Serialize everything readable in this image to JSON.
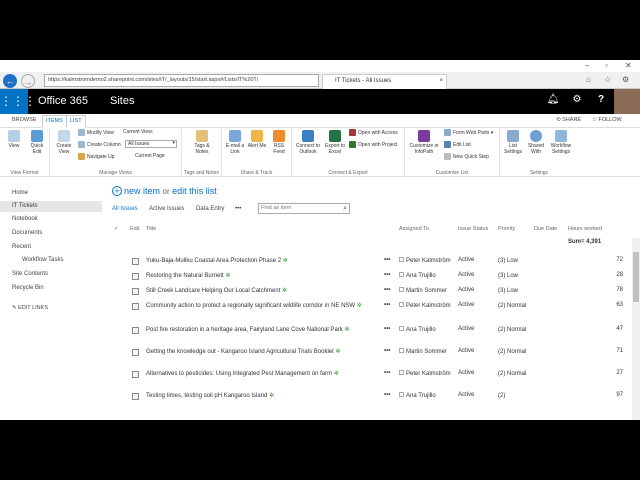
{
  "browser": {
    "url": "https://kalmstromdemo2.sharepoint.com/sites/IT/_layouts/15/start.aspx#/Lists/IT%20Ti",
    "tab_title": "IT Tickets - All Issues",
    "tab_close": "×"
  },
  "suitebar": {
    "brand": "Office 365",
    "app": "Sites"
  },
  "ribbon_tabs": [
    "BROWSE",
    "ITEMS",
    "LIST"
  ],
  "share_label": "SHARE",
  "follow_label": "FOLLOW",
  "ribbon": {
    "view_format": {
      "label": "View Format",
      "view": "View",
      "quick_edit": "Quick Edit"
    },
    "manage_views": {
      "label": "Manage Views",
      "create_view": "Create View",
      "modify_view": "Modify View",
      "create_column": "Create Column",
      "navigate_up": "Navigate Up",
      "current_view_label": "Current View:",
      "current_view_value": "All Issues",
      "current_page": "Current Page"
    },
    "tags_notes": {
      "label": "Tags and Notes",
      "tags": "Tags & Notes"
    },
    "share_track": {
      "label": "Share & Track",
      "email": "E-mail a Link",
      "alert": "Alert Me",
      "rss": "RSS Feed"
    },
    "connect_export": {
      "label": "Connect & Export",
      "outlook": "Connect to Outlook",
      "excel": "Export to Excel",
      "access": "Open with Access",
      "project": "Open with Project"
    },
    "customize_list": {
      "label": "Customize List",
      "infopath": "Customize in InfoPath",
      "form_web_parts": "Form Web Parts",
      "edit_list": "Edit List",
      "quick_step": "New Quick Step"
    },
    "settings": {
      "label": "Settings",
      "list_settings": "List Settings",
      "shared_with": "Shared With",
      "workflow_settings": "Workflow Settings"
    }
  },
  "leftnav": {
    "items": [
      "Home",
      "IT Tickets",
      "Notebook",
      "Documents",
      "Recent",
      "Workflow Tasks",
      "Site Contents",
      "Recycle Bin"
    ],
    "edit_links": "EDIT LINKS"
  },
  "list": {
    "new_item": "new item",
    "or_text": "or",
    "edit_list": "edit this list",
    "views": [
      "All Issues",
      "Active Issues",
      "Data Entry"
    ],
    "more_views": "•••",
    "search_placeholder": "Find an item",
    "columns": {
      "edit": "Edit",
      "title": "Title",
      "assigned": "Assigned To",
      "status": "Issue Status",
      "priority": "Priority",
      "due": "Due Date",
      "hours": "Hours worked"
    },
    "sum": "Sum= 4,391",
    "new_marker": "✲",
    "row_menu": "•••",
    "rows": [
      {
        "title": "Yuku-Baja-Muliku Coastal Area Protection Phase 2",
        "assigned": "Peter Kalmström",
        "status": "Active",
        "priority": "(3) Low",
        "hours": "72"
      },
      {
        "title": "Restoring the Natural Burnett",
        "assigned": "Ana Trujillo",
        "status": "Active",
        "priority": "(3) Low",
        "hours": "28"
      },
      {
        "title": "Still Creek Landcare Helping Our Local Catchment",
        "assigned": "Martin Sommer",
        "status": "Active",
        "priority": "(3) Low",
        "hours": "78"
      },
      {
        "title": "Community action to protect a regionally significant wildlife corridor in NE NSW",
        "assigned": "Peter Kalmström",
        "status": "Active",
        "priority": "(2) Normal",
        "hours": "63"
      },
      {
        "title": "Post fire restoration in a heritage area, Fairyland Lane Cove National Park",
        "assigned": "Ana Trujillo",
        "status": "Active",
        "priority": "(2) Normal",
        "hours": "47"
      },
      {
        "title": "Getting the knowledge out - Kangaroo Island Agricultural Trials Booklet",
        "assigned": "Martin Sommer",
        "status": "Active",
        "priority": "(2) Normal",
        "hours": "71"
      },
      {
        "title": "Alternatives to pesticides: Using Integrated Pest Management on farm",
        "assigned": "Peter Kalmström",
        "status": "Active",
        "priority": "(2) Normal",
        "hours": "27"
      },
      {
        "title": "Testing times, testing soil pH Kangaroo Island",
        "assigned": "Ana Trujillo",
        "status": "Active",
        "priority": "(2)",
        "hours": "97"
      }
    ]
  },
  "colors": {
    "accent": "#0072c6",
    "suitebar": "#000000",
    "taskbar": "#1f3c74"
  }
}
